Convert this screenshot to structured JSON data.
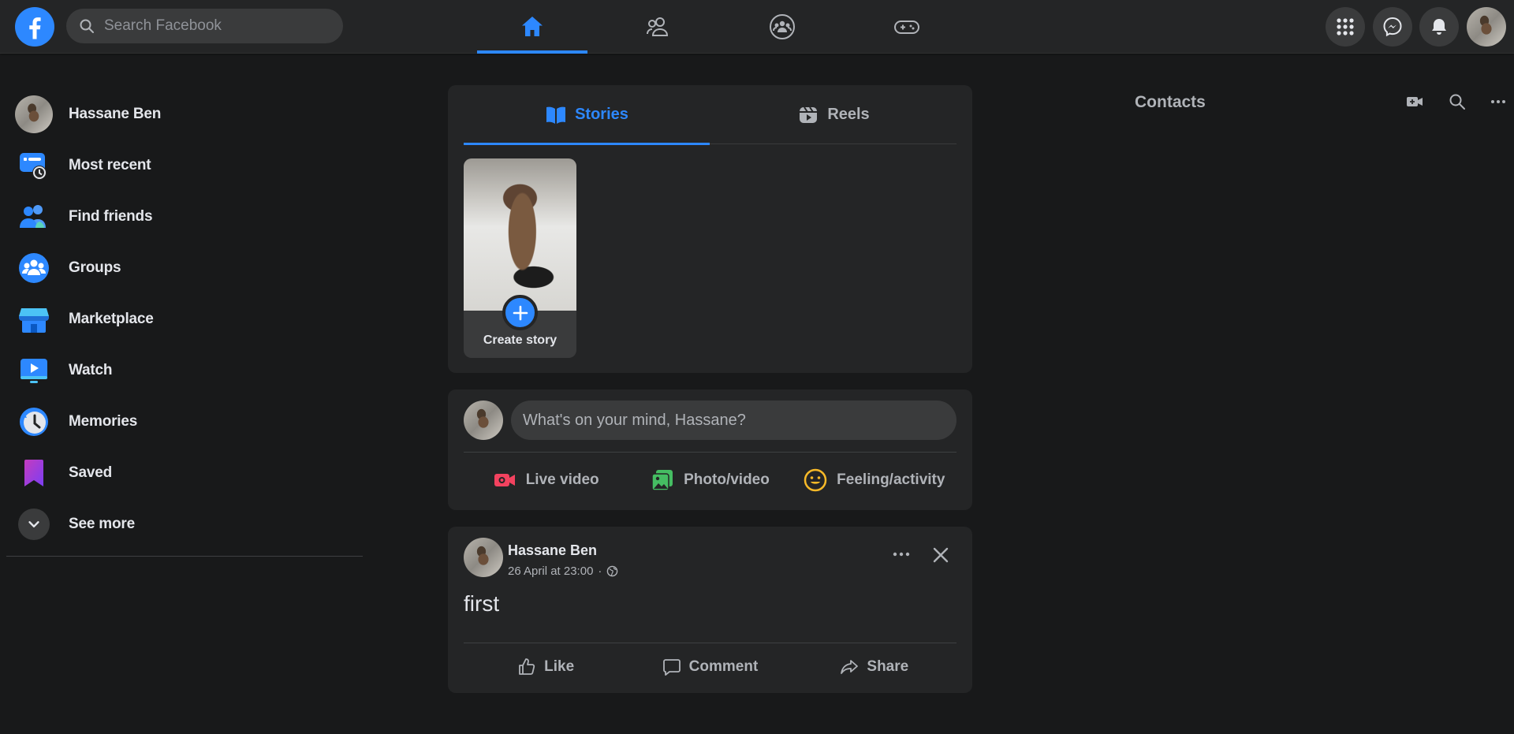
{
  "header": {
    "search_placeholder": "Search Facebook",
    "nav_tabs": [
      {
        "name": "home",
        "icon": "home-icon",
        "active": true
      },
      {
        "name": "friends",
        "icon": "friends-icon",
        "active": false
      },
      {
        "name": "groups",
        "icon": "groups-icon",
        "active": false
      },
      {
        "name": "gaming",
        "icon": "gaming-icon",
        "active": false
      }
    ],
    "right_buttons": [
      "menu-grid-icon",
      "messenger-icon",
      "notifications-bell-icon",
      "account-avatar"
    ]
  },
  "sidebar": {
    "items": [
      {
        "label": "Hassane Ben",
        "icon": "profile-avatar"
      },
      {
        "label": "Most recent",
        "icon": "most-recent-icon"
      },
      {
        "label": "Find friends",
        "icon": "find-friends-icon"
      },
      {
        "label": "Groups",
        "icon": "groups-icon"
      },
      {
        "label": "Marketplace",
        "icon": "marketplace-icon"
      },
      {
        "label": "Watch",
        "icon": "watch-icon"
      },
      {
        "label": "Memories",
        "icon": "memories-icon"
      },
      {
        "label": "Saved",
        "icon": "saved-icon"
      },
      {
        "label": "See more",
        "icon": "chevron-down-icon"
      }
    ]
  },
  "stories": {
    "tabs": [
      {
        "label": "Stories",
        "active": true
      },
      {
        "label": "Reels",
        "active": false
      }
    ],
    "create_story_label": "Create story"
  },
  "composer": {
    "placeholder": "What's on your mind, Hassane?",
    "actions": [
      {
        "label": "Live video",
        "icon": "live-video-icon"
      },
      {
        "label": "Photo/video",
        "icon": "photo-video-icon"
      },
      {
        "label": "Feeling/activity",
        "icon": "feeling-icon"
      }
    ]
  },
  "post": {
    "author": "Hassane Ben",
    "timestamp": "26 April at 23:00",
    "separator": "·",
    "text": "first",
    "actions": [
      {
        "label": "Like",
        "icon": "like-icon"
      },
      {
        "label": "Comment",
        "icon": "comment-icon"
      },
      {
        "label": "Share",
        "icon": "share-icon"
      }
    ]
  },
  "contacts": {
    "title": "Contacts",
    "tools": [
      "new-room-icon",
      "search-icon",
      "more-options-icon"
    ]
  },
  "colors": {
    "background": "#18191a",
    "surface": "#242526",
    "input": "#3a3b3c",
    "accent": "#2d88ff",
    "text_primary": "#e4e6eb",
    "text_secondary": "#b0b3b8"
  }
}
